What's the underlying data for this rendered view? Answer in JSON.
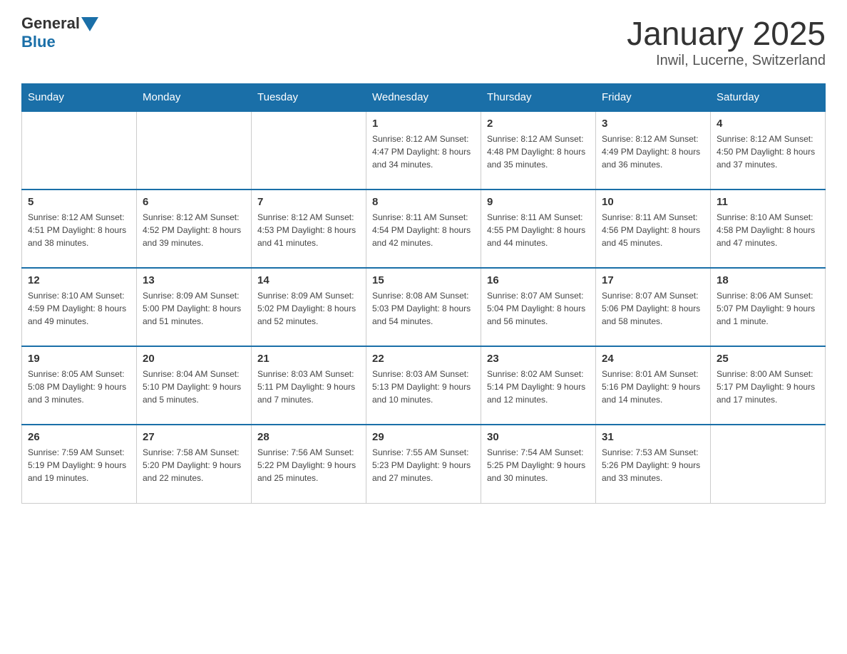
{
  "logo": {
    "general": "General",
    "blue": "Blue"
  },
  "header": {
    "title": "January 2025",
    "subtitle": "Inwil, Lucerne, Switzerland"
  },
  "weekdays": [
    "Sunday",
    "Monday",
    "Tuesday",
    "Wednesday",
    "Thursday",
    "Friday",
    "Saturday"
  ],
  "weeks": [
    [
      {
        "day": "",
        "info": ""
      },
      {
        "day": "",
        "info": ""
      },
      {
        "day": "",
        "info": ""
      },
      {
        "day": "1",
        "info": "Sunrise: 8:12 AM\nSunset: 4:47 PM\nDaylight: 8 hours\nand 34 minutes."
      },
      {
        "day": "2",
        "info": "Sunrise: 8:12 AM\nSunset: 4:48 PM\nDaylight: 8 hours\nand 35 minutes."
      },
      {
        "day": "3",
        "info": "Sunrise: 8:12 AM\nSunset: 4:49 PM\nDaylight: 8 hours\nand 36 minutes."
      },
      {
        "day": "4",
        "info": "Sunrise: 8:12 AM\nSunset: 4:50 PM\nDaylight: 8 hours\nand 37 minutes."
      }
    ],
    [
      {
        "day": "5",
        "info": "Sunrise: 8:12 AM\nSunset: 4:51 PM\nDaylight: 8 hours\nand 38 minutes."
      },
      {
        "day": "6",
        "info": "Sunrise: 8:12 AM\nSunset: 4:52 PM\nDaylight: 8 hours\nand 39 minutes."
      },
      {
        "day": "7",
        "info": "Sunrise: 8:12 AM\nSunset: 4:53 PM\nDaylight: 8 hours\nand 41 minutes."
      },
      {
        "day": "8",
        "info": "Sunrise: 8:11 AM\nSunset: 4:54 PM\nDaylight: 8 hours\nand 42 minutes."
      },
      {
        "day": "9",
        "info": "Sunrise: 8:11 AM\nSunset: 4:55 PM\nDaylight: 8 hours\nand 44 minutes."
      },
      {
        "day": "10",
        "info": "Sunrise: 8:11 AM\nSunset: 4:56 PM\nDaylight: 8 hours\nand 45 minutes."
      },
      {
        "day": "11",
        "info": "Sunrise: 8:10 AM\nSunset: 4:58 PM\nDaylight: 8 hours\nand 47 minutes."
      }
    ],
    [
      {
        "day": "12",
        "info": "Sunrise: 8:10 AM\nSunset: 4:59 PM\nDaylight: 8 hours\nand 49 minutes."
      },
      {
        "day": "13",
        "info": "Sunrise: 8:09 AM\nSunset: 5:00 PM\nDaylight: 8 hours\nand 51 minutes."
      },
      {
        "day": "14",
        "info": "Sunrise: 8:09 AM\nSunset: 5:02 PM\nDaylight: 8 hours\nand 52 minutes."
      },
      {
        "day": "15",
        "info": "Sunrise: 8:08 AM\nSunset: 5:03 PM\nDaylight: 8 hours\nand 54 minutes."
      },
      {
        "day": "16",
        "info": "Sunrise: 8:07 AM\nSunset: 5:04 PM\nDaylight: 8 hours\nand 56 minutes."
      },
      {
        "day": "17",
        "info": "Sunrise: 8:07 AM\nSunset: 5:06 PM\nDaylight: 8 hours\nand 58 minutes."
      },
      {
        "day": "18",
        "info": "Sunrise: 8:06 AM\nSunset: 5:07 PM\nDaylight: 9 hours\nand 1 minute."
      }
    ],
    [
      {
        "day": "19",
        "info": "Sunrise: 8:05 AM\nSunset: 5:08 PM\nDaylight: 9 hours\nand 3 minutes."
      },
      {
        "day": "20",
        "info": "Sunrise: 8:04 AM\nSunset: 5:10 PM\nDaylight: 9 hours\nand 5 minutes."
      },
      {
        "day": "21",
        "info": "Sunrise: 8:03 AM\nSunset: 5:11 PM\nDaylight: 9 hours\nand 7 minutes."
      },
      {
        "day": "22",
        "info": "Sunrise: 8:03 AM\nSunset: 5:13 PM\nDaylight: 9 hours\nand 10 minutes."
      },
      {
        "day": "23",
        "info": "Sunrise: 8:02 AM\nSunset: 5:14 PM\nDaylight: 9 hours\nand 12 minutes."
      },
      {
        "day": "24",
        "info": "Sunrise: 8:01 AM\nSunset: 5:16 PM\nDaylight: 9 hours\nand 14 minutes."
      },
      {
        "day": "25",
        "info": "Sunrise: 8:00 AM\nSunset: 5:17 PM\nDaylight: 9 hours\nand 17 minutes."
      }
    ],
    [
      {
        "day": "26",
        "info": "Sunrise: 7:59 AM\nSunset: 5:19 PM\nDaylight: 9 hours\nand 19 minutes."
      },
      {
        "day": "27",
        "info": "Sunrise: 7:58 AM\nSunset: 5:20 PM\nDaylight: 9 hours\nand 22 minutes."
      },
      {
        "day": "28",
        "info": "Sunrise: 7:56 AM\nSunset: 5:22 PM\nDaylight: 9 hours\nand 25 minutes."
      },
      {
        "day": "29",
        "info": "Sunrise: 7:55 AM\nSunset: 5:23 PM\nDaylight: 9 hours\nand 27 minutes."
      },
      {
        "day": "30",
        "info": "Sunrise: 7:54 AM\nSunset: 5:25 PM\nDaylight: 9 hours\nand 30 minutes."
      },
      {
        "day": "31",
        "info": "Sunrise: 7:53 AM\nSunset: 5:26 PM\nDaylight: 9 hours\nand 33 minutes."
      },
      {
        "day": "",
        "info": ""
      }
    ]
  ]
}
